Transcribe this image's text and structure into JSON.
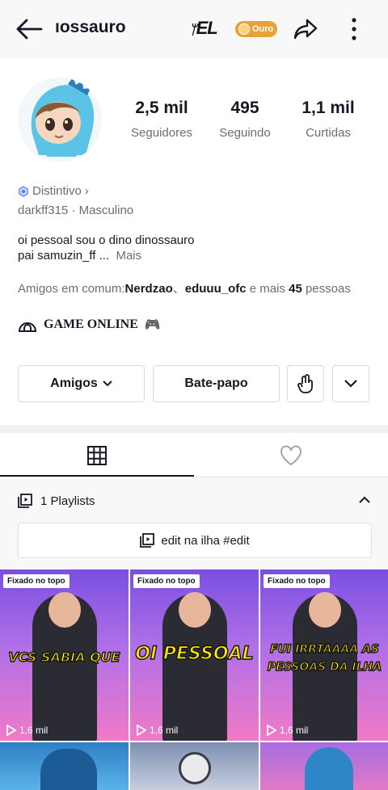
{
  "header": {
    "title": "ıossauro",
    "logo_text": "EL",
    "badge_label": "Ouro"
  },
  "profile": {
    "stats": [
      {
        "value": "2,5 mil",
        "label": "Seguidores"
      },
      {
        "value": "495",
        "label": "Seguindo"
      },
      {
        "value": "1,1 mil",
        "label": "Curtidas"
      }
    ],
    "badge_label": "Distintivo",
    "badge_chevron": "›",
    "username": "darkff315",
    "gender": "Masculino",
    "bio_line1": "oi pessoal sou o dino dinossauro",
    "bio_line2": "pai samuzin_ff ...",
    "bio_more": "Mais",
    "mutual_prefix": "Amigos em comum:",
    "mutual_name1": "Nerdzao",
    "mutual_sep": "、",
    "mutual_name2": "eduuu_ofc",
    "mutual_mid": " e mais ",
    "mutual_count": "45",
    "mutual_suffix": " pessoas",
    "status_text": "GAME ONLINE",
    "status_emoji": "🎮"
  },
  "actions": {
    "friends_label": "Amigos",
    "chat_label": "Bate-papo"
  },
  "playlists": {
    "header_label": "1 Playlists",
    "item_label": "edit na ilha #edit"
  },
  "videos": [
    {
      "pinned": "Fixado no topo",
      "caption": "VCS SABIA QUE",
      "views": "1,6 mil"
    },
    {
      "pinned": "Fixado no topo",
      "caption": "OI PESSOAL",
      "views": "1,6 mil"
    },
    {
      "pinned": "Fixado no topo",
      "caption": "FUI IRRTAAAA AS PESSOAS DA ILHA",
      "views": "1,6 mil"
    }
  ],
  "colors": {
    "text_primary": "#161823",
    "text_secondary": "#6b6d75",
    "badge_gold": "#e9a13a",
    "caption_yellow": "#ffea00"
  },
  "icons": [
    "back-arrow-icon",
    "share-icon",
    "more-vertical-icon",
    "hexagon-badge-icon",
    "igloo-icon",
    "gamepad-icon",
    "chevron-down-icon",
    "hand-wave-icon",
    "grid-icon",
    "heart-icon",
    "playlist-icon",
    "chevron-up-icon",
    "play-icon"
  ]
}
